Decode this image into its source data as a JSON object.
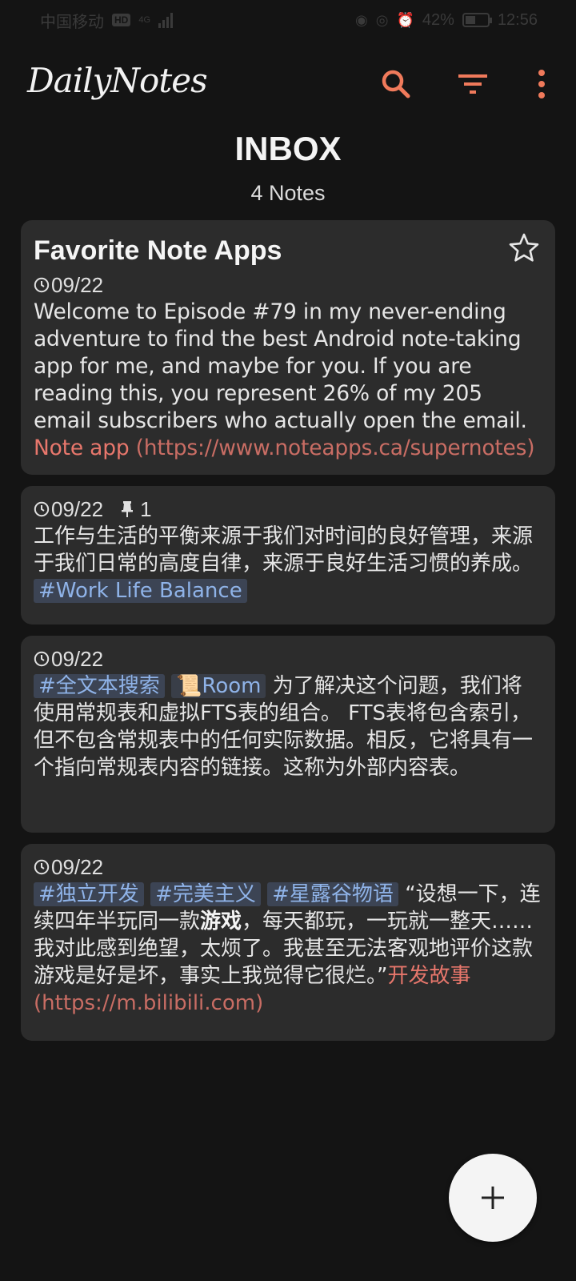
{
  "status_bar": {
    "carrier": "中国移动",
    "network": "4G",
    "battery": "42%",
    "time": "12:56"
  },
  "app": {
    "title": "DailyNotes",
    "accent_color": "#f07a5b"
  },
  "header": {
    "title": "INBOX",
    "count": "4 Notes"
  },
  "notes": [
    {
      "title": "Favorite Note Apps",
      "date": "09/22",
      "text": "Welcome to Episode #79 in my never-ending adventure to find the best Android note-taking app for me, and maybe for you. If you are reading this, you represent 26% of my 205 email subscribers who actually open the email. ",
      "link_label": "Note app",
      "link_url": "(https://www.noteapps.ca/supernotes)"
    },
    {
      "date": "09/22",
      "pin_count": "1",
      "text": "工作与生活的平衡来源于我们对时间的良好管理，来源于我们日常的高度自律，来源于良好生活习惯的养成。",
      "tag": "#Work Life Balance"
    },
    {
      "date": "09/22",
      "tags": [
        "#全文本搜索",
        "📜Room"
      ],
      "text": "为了解决这个问题，我们将使用常规表和虚拟FTS表的组合。 FTS表将包含索引，但不包含常规表中的任何实际数据。相反，它将具有一个指向常规表内容的链接。这称为外部内容表。"
    },
    {
      "date": "09/22",
      "tags": [
        "#独立开发",
        "#完美主义",
        "#星露谷物语"
      ],
      "text_before": "“设想一下，连续四年半玩同一款",
      "text_bold": "游戏",
      "text_after": "，每天都玩，一玩就一整天……我对此感到绝望，太烦了。我甚至无法客观地评价这款游戏是好是坏，事实上我觉得它很烂。”",
      "link_label": "开发故事",
      "link_url": "(https://m.bilibili.com)"
    }
  ],
  "fab": {
    "icon": "plus-icon"
  }
}
